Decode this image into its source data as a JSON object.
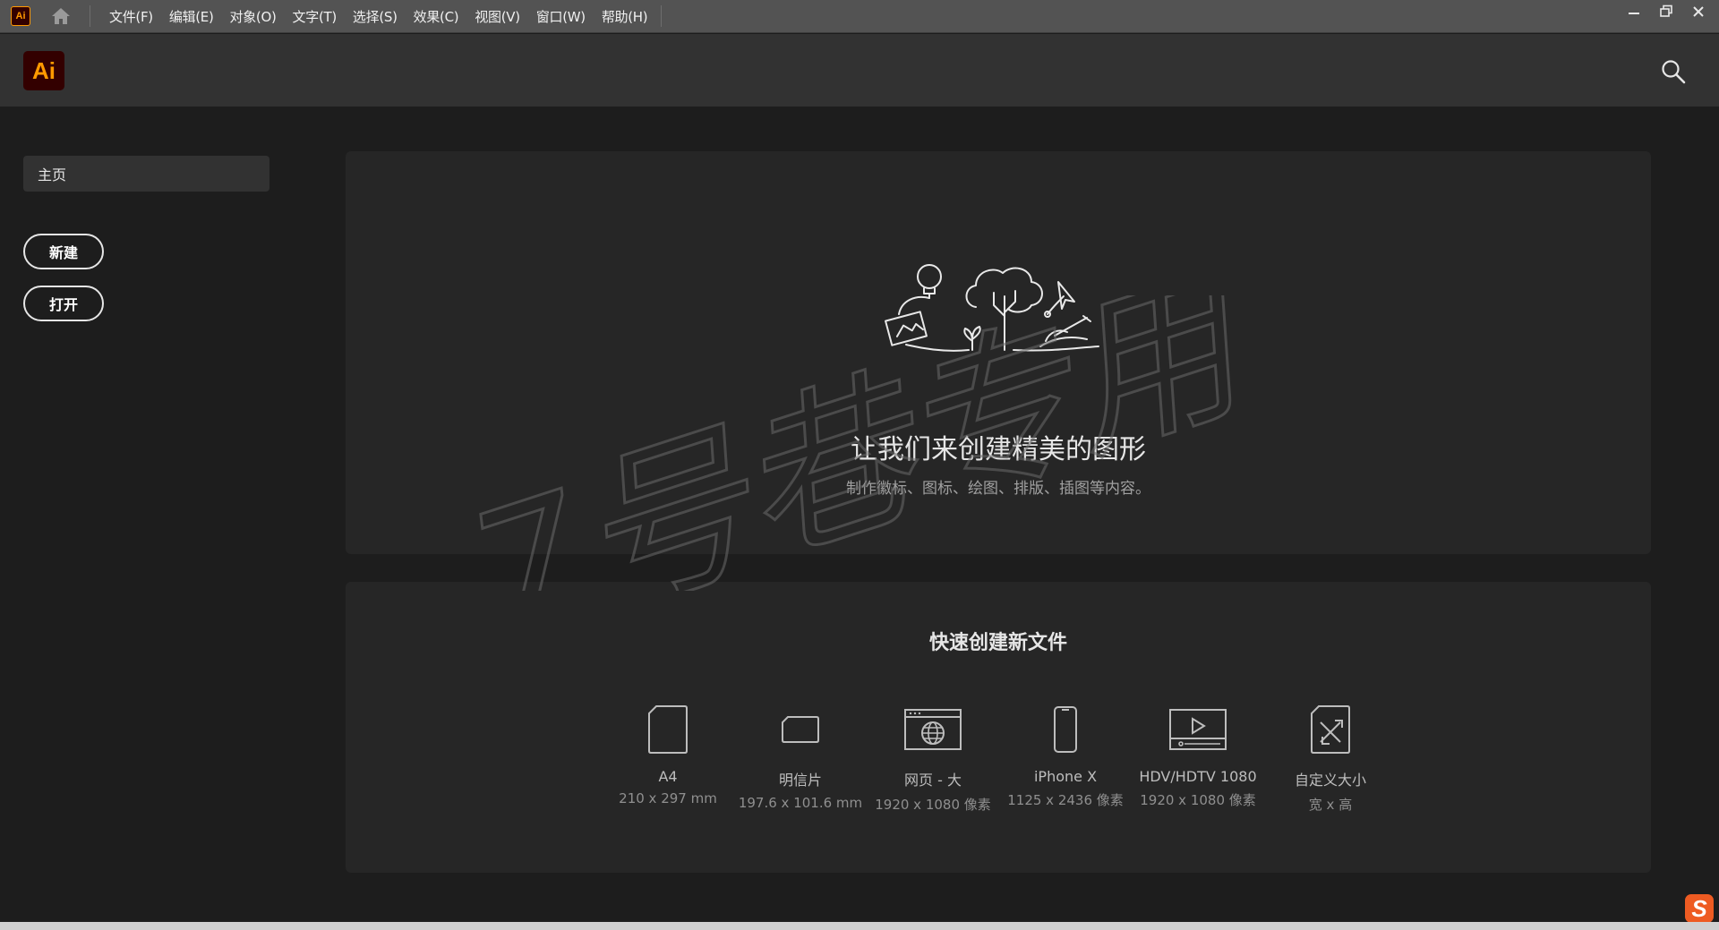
{
  "app": {
    "mini_logo": "Ai",
    "logo_text": "Ai",
    "brand_color": "#ff9a00",
    "brand_bg": "#330000"
  },
  "menu": [
    "文件(F)",
    "编辑(E)",
    "对象(O)",
    "文字(T)",
    "选择(S)",
    "效果(C)",
    "视图(V)",
    "窗口(W)",
    "帮助(H)"
  ],
  "icons": {
    "home": "home-icon",
    "search": "search-icon",
    "minimize": "minimize-icon",
    "restore": "restore-icon",
    "close": "close-icon"
  },
  "sidebar": {
    "home_label": "主页",
    "new_label": "新建",
    "open_label": "打开"
  },
  "hero": {
    "title": "让我们来创建精美的图形",
    "subtitle": "制作徽标、图标、绘图、排版、插图等内容。"
  },
  "quick_create": {
    "title": "快速创建新文件",
    "presets": [
      {
        "name": "A4",
        "size": "210 x 297 mm",
        "icon": "document-icon"
      },
      {
        "name": "明信片",
        "size": "197.6 x 101.6 mm",
        "icon": "postcard-icon"
      },
      {
        "name": "网页 - 大",
        "size": "1920 x 1080 像素",
        "icon": "web-page-icon"
      },
      {
        "name": "iPhone X",
        "size": "1125 x 2436 像素",
        "icon": "phone-icon"
      },
      {
        "name": "HDV/HDTV 1080",
        "size": "1920 x 1080 像素",
        "icon": "video-icon"
      },
      {
        "name": "自定义大小",
        "size": "宽 x 高",
        "icon": "custom-size-icon"
      }
    ]
  },
  "watermark": "7号巷专用",
  "ime_badge": "S"
}
